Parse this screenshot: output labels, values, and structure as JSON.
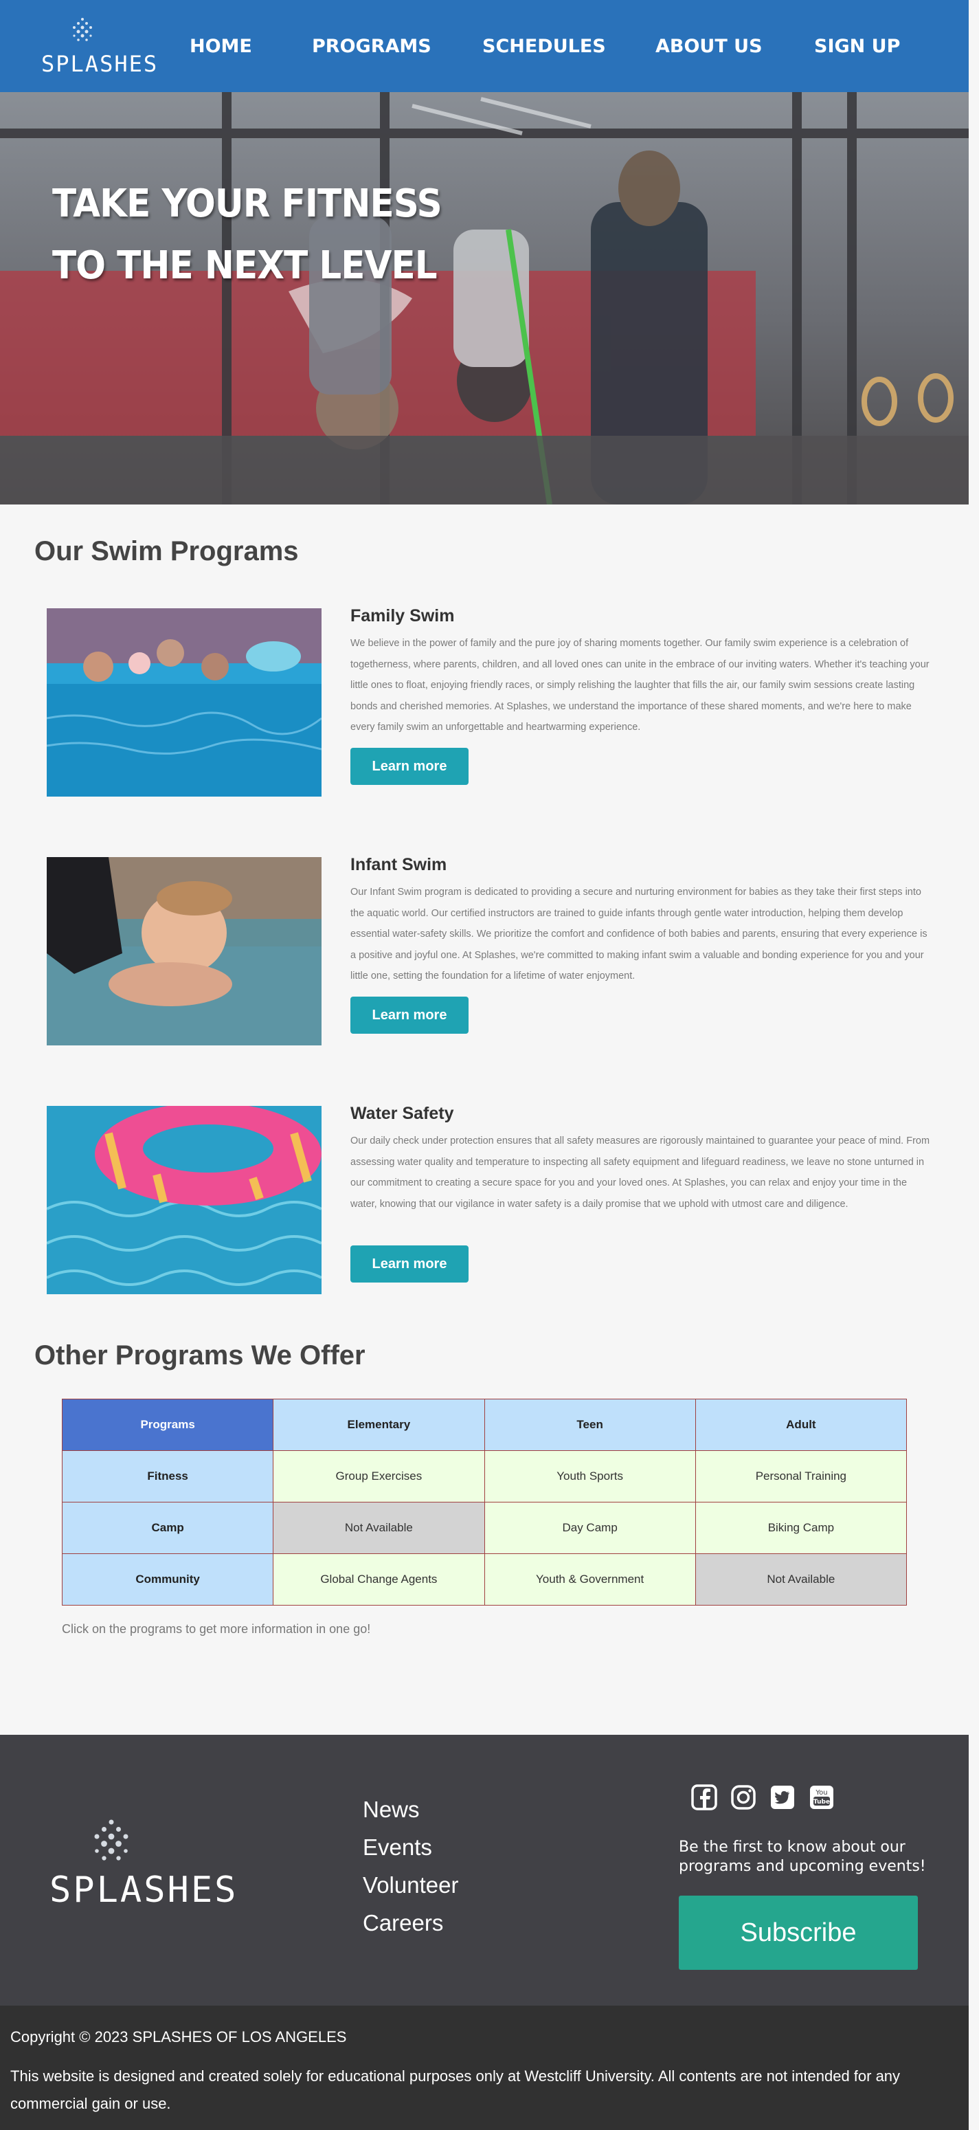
{
  "header": {
    "logo_text": "SPLASHES",
    "nav": [
      {
        "label": "HOME"
      },
      {
        "label": "PROGRAMS"
      },
      {
        "label": "SCHEDULES"
      },
      {
        "label": "ABOUT US"
      },
      {
        "label": "SIGN UP"
      }
    ]
  },
  "hero": {
    "line1": "TAKE YOUR FITNESS",
    "line2": "TO THE NEXT LEVEL"
  },
  "programs": {
    "title": "Our Swim Programs",
    "items": [
      {
        "title": "Family Swim",
        "description": "We believe in the power of family and the pure joy of sharing moments together. Our family swim experience is a celebration of togetherness, where parents, children, and all loved ones can unite in the embrace of our inviting waters. Whether it's teaching your little ones to float, enjoying friendly races, or simply relishing the laughter that fills the air, our family swim sessions create lasting bonds and cherished memories. At Splashes, we understand the importance of these shared moments, and we're here to make every family swim an unforgettable and heartwarming experience.",
        "button": "Learn more"
      },
      {
        "title": "Infant Swim",
        "description": "Our Infant Swim program is dedicated to providing a secure and nurturing environment for babies as they take their first steps into the aquatic world. Our certified instructors are trained to guide infants through gentle water introduction, helping them develop essential water-safety skills. We prioritize the comfort and confidence of both babies and parents, ensuring that every experience is a positive and joyful one. At Splashes, we're committed to making infant swim a valuable and bonding experience for you and your little one, setting the foundation for a lifetime of water enjoyment.",
        "button": "Learn more"
      },
      {
        "title": "Water Safety",
        "description": "Our daily check under protection ensures that all safety measures are rigorously maintained to guarantee your peace of mind. From assessing water quality and temperature to inspecting all safety equipment and lifeguard readiness, we leave no stone unturned in our commitment to creating a secure space for you and your loved ones. At Splashes, you can relax and enjoy your time in the water, knowing that our vigilance in water safety is a daily promise that we uphold with utmost care and diligence.",
        "button": "Learn more"
      }
    ]
  },
  "other": {
    "title": "Other Programs We Offer",
    "headers": [
      "Programs",
      "Elementary",
      "Teen",
      "Adult"
    ],
    "rows": [
      {
        "label": "Fitness",
        "cells": [
          "Group Exercises",
          "Youth Sports",
          "Personal Training"
        ]
      },
      {
        "label": "Camp",
        "cells": [
          "Not Available",
          "Day Camp",
          "Biking Camp"
        ]
      },
      {
        "label": "Community",
        "cells": [
          "Global Change Agents",
          "Youth & Government",
          "Not Available"
        ]
      }
    ],
    "note": "Click on the programs to get more information in one go!"
  },
  "footer": {
    "logo_text": "SPLASHES",
    "links": [
      "News",
      "Events",
      "Volunteer",
      "Careers"
    ],
    "social_icons": [
      "facebook-icon",
      "instagram-icon",
      "twitter-icon",
      "youtube-icon"
    ],
    "tagline": "Be the first to know about our programs and upcoming events!",
    "subscribe": "Subscribe"
  },
  "copyright": {
    "line1": "Copyright © 2023 SPLASHES OF LOS ANGELES",
    "line2": "This website is designed and created solely for educational purposes only at Westcliff University. All contents are not intended for any commercial gain or use."
  },
  "colors": {
    "header_bg": "#2a72ba",
    "button": "#1fa3b3",
    "subscribe": "#25a68e",
    "footer_bg": "#414146",
    "copyright_bg": "#313131"
  }
}
